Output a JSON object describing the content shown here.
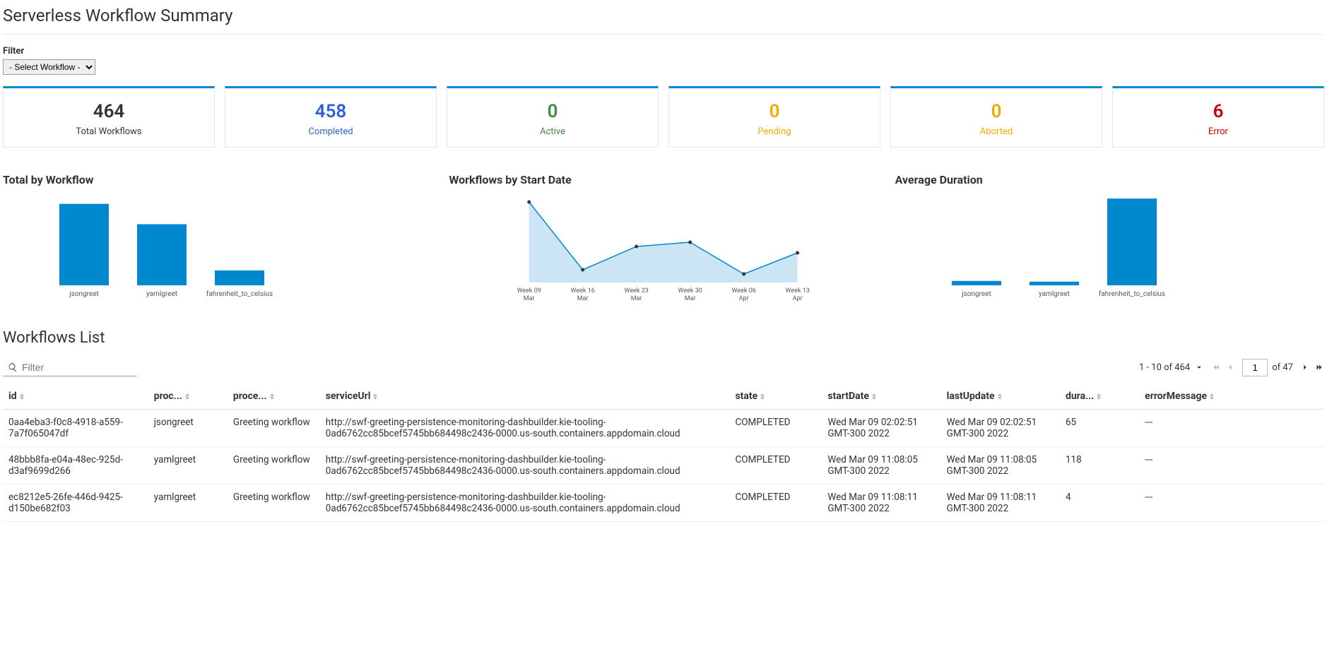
{
  "title": "Serverless Workflow Summary",
  "filter": {
    "label": "Filter",
    "placeholder": "- Select Workflow -"
  },
  "stats": {
    "total": {
      "value": "464",
      "label": "Total Workflows"
    },
    "completed": {
      "value": "458",
      "label": "Completed"
    },
    "active": {
      "value": "0",
      "label": "Active"
    },
    "pending": {
      "value": "0",
      "label": "Pending"
    },
    "aborted": {
      "value": "0",
      "label": "Aborted"
    },
    "error": {
      "value": "6",
      "label": "Error"
    }
  },
  "charts": {
    "titles": {
      "byWorkflow": "Total by Workflow",
      "byStartDate": "Workflows by Start Date",
      "avgDuration": "Average Duration"
    }
  },
  "chart_data": [
    {
      "type": "bar",
      "title": "Total by Workflow",
      "categories": [
        "jsongreet",
        "yamlgreet",
        "fahrenheit_to_celsius"
      ],
      "values": [
        240,
        180,
        44
      ],
      "ylim": [
        0,
        260
      ]
    },
    {
      "type": "area",
      "title": "Workflows by Start Date",
      "categories": [
        "Week 09 Mar",
        "Week 16 Mar",
        "Week 23 Mar",
        "Week 30 Mar",
        "Week 06 Apr",
        "Week 13 Apr"
      ],
      "values": [
        190,
        30,
        85,
        95,
        20,
        70
      ],
      "ylim": [
        0,
        200
      ]
    },
    {
      "type": "bar",
      "title": "Average Duration",
      "categories": [
        "jsongreet",
        "yamlgreet",
        "fahrenheit_to_celsius"
      ],
      "values": [
        6,
        5,
        118
      ],
      "ylim": [
        0,
        120
      ]
    }
  ],
  "list": {
    "title": "Workflows List",
    "search_placeholder": "Filter",
    "range": "1 - 10 of 464",
    "page": "1",
    "page_total": "of 47",
    "columns": {
      "id": "id",
      "processId": "proc...",
      "processName": "proce...",
      "serviceUrl": "serviceUrl",
      "state": "state",
      "startDate": "startDate",
      "lastUpdate": "lastUpdate",
      "duration": "dura...",
      "errorMessage": "errorMessage"
    },
    "rows": [
      {
        "id": "0aa4eba3-f0c8-4918-a559-7a7f065047df",
        "processId": "jsongreet",
        "processName": "Greeting workflow",
        "serviceUrl": "http://swf-greeting-persistence-monitoring-dashbuilder.kie-tooling-0ad6762cc85bcef5745bb684498c2436-0000.us-south.containers.appdomain.cloud",
        "state": "COMPLETED",
        "startDate": "Wed Mar 09 02:02:51 GMT-300 2022",
        "lastUpdate": "Wed Mar 09 02:02:51 GMT-300 2022",
        "duration": "65",
        "errorMessage": "---"
      },
      {
        "id": "48bbb8fa-e04a-48ec-925d-d3af9699d266",
        "processId": "yamlgreet",
        "processName": "Greeting workflow",
        "serviceUrl": "http://swf-greeting-persistence-monitoring-dashbuilder.kie-tooling-0ad6762cc85bcef5745bb684498c2436-0000.us-south.containers.appdomain.cloud",
        "state": "COMPLETED",
        "startDate": "Wed Mar 09 11:08:05 GMT-300 2022",
        "lastUpdate": "Wed Mar 09 11:08:05 GMT-300 2022",
        "duration": "118",
        "errorMessage": "---"
      },
      {
        "id": "ec8212e5-26fe-446d-9425-d150be682f03",
        "processId": "yamlgreet",
        "processName": "Greeting workflow",
        "serviceUrl": "http://swf-greeting-persistence-monitoring-dashbuilder.kie-tooling-0ad6762cc85bcef5745bb684498c2436-0000.us-south.containers.appdomain.cloud",
        "state": "COMPLETED",
        "startDate": "Wed Mar 09 11:08:11 GMT-300 2022",
        "lastUpdate": "Wed Mar 09 11:08:11 GMT-300 2022",
        "duration": "4",
        "errorMessage": "---"
      }
    ]
  }
}
